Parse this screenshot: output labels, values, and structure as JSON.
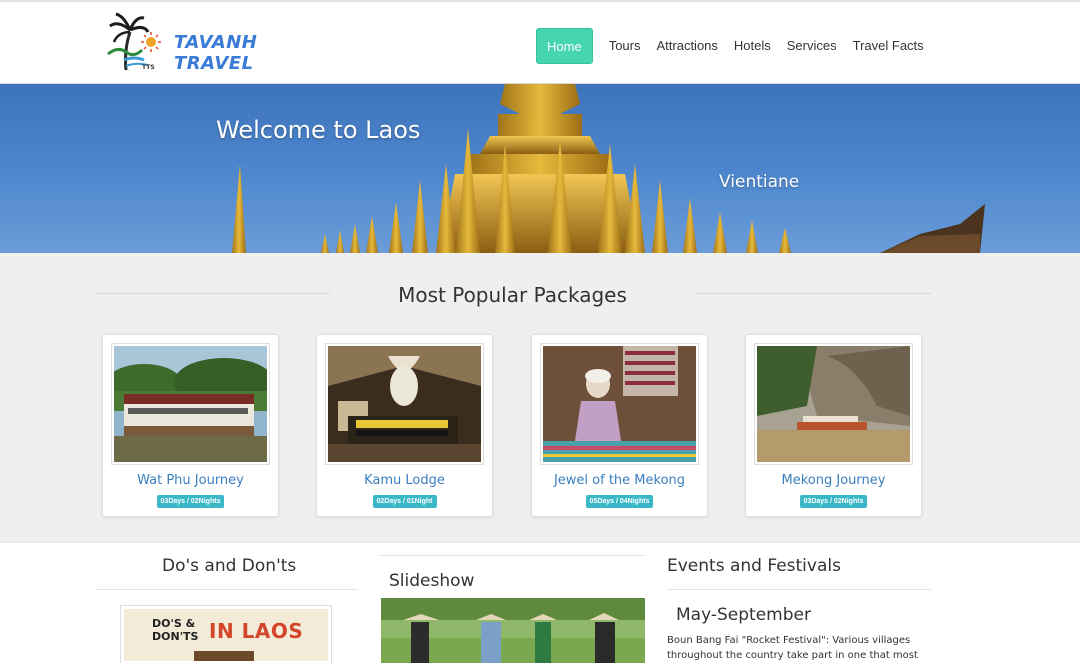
{
  "brand": {
    "name": "TAVANH TRAVEL",
    "tagline": "TTS"
  },
  "nav": {
    "items": [
      "Home",
      "Tours",
      "Attractions",
      "Hotels",
      "Services",
      "Travel Facts"
    ],
    "active": "Home"
  },
  "hero": {
    "title": "Welcome to Laos",
    "subtitle": "Vientiane"
  },
  "packages": {
    "heading": "Most Popular Packages",
    "cards": [
      {
        "title": "Wat Phu Journey",
        "duration": "03Days / 02Nights"
      },
      {
        "title": "Kamu Lodge",
        "duration": "02Days / 01Night"
      },
      {
        "title": "Jewel of the Mekong",
        "duration": "05Days / 04Nights"
      },
      {
        "title": "Mekong Journey",
        "duration": "03Days / 02Nights"
      }
    ]
  },
  "bottom": {
    "dos_title": "Do's and Don'ts",
    "dos_image_small": "DO'S & DON'TS",
    "dos_image_big": "IN LAOS",
    "slideshow_title": "Slideshow",
    "events_title": "Events and Festivals",
    "event_period": "May-September",
    "event_text": "Boun Bang Fai \"Rocket Festival\": Various villages throughout the country take part in one that most"
  },
  "colors": {
    "accent": "#45d6b0",
    "link": "#3a7ec0",
    "badge": "#3bb8c8",
    "brand": "#3a7bd5"
  }
}
